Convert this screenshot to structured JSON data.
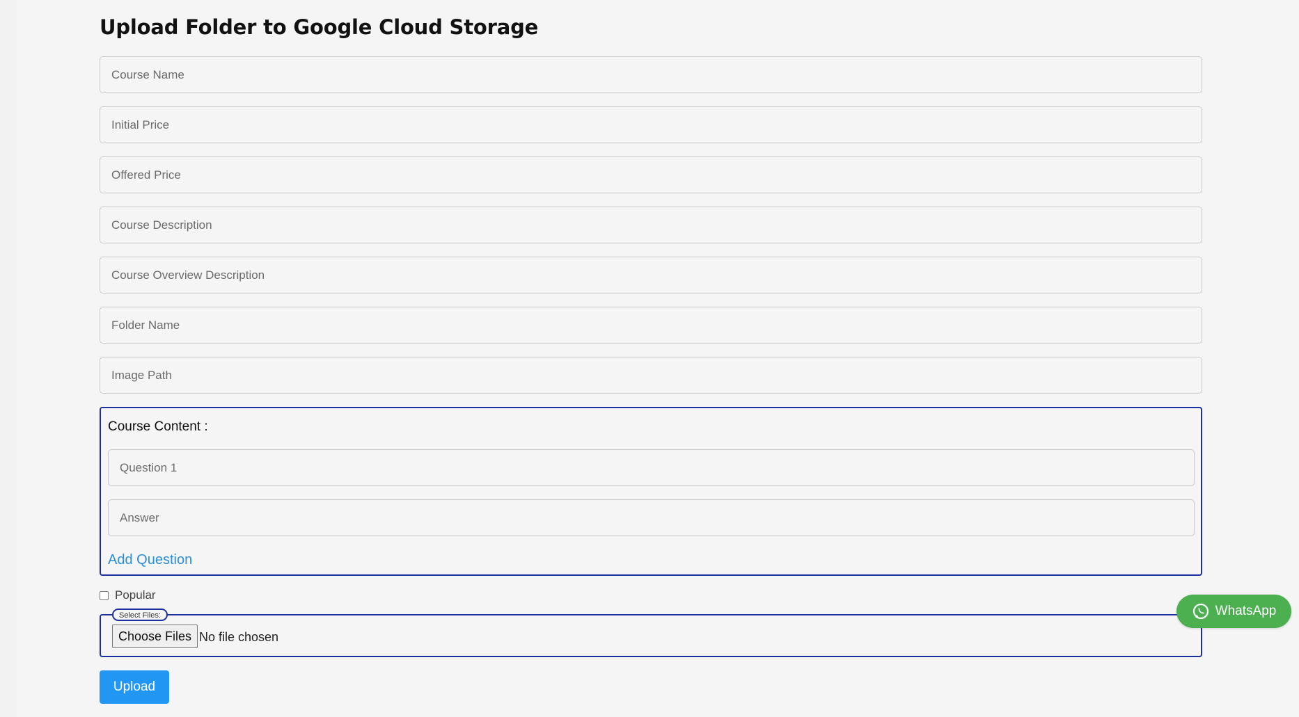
{
  "page": {
    "title": "Upload Folder to Google Cloud Storage"
  },
  "form": {
    "fields": [
      {
        "name": "course-name-input",
        "placeholder": "Course Name",
        "value": ""
      },
      {
        "name": "initial-price-input",
        "placeholder": "Initial Price",
        "value": ""
      },
      {
        "name": "offered-price-input",
        "placeholder": "Offered Price",
        "value": ""
      },
      {
        "name": "course-description-input",
        "placeholder": "Course Description",
        "value": ""
      },
      {
        "name": "course-overview-description-input",
        "placeholder": "Course Overview Description",
        "value": ""
      },
      {
        "name": "folder-name-input",
        "placeholder": "Folder Name",
        "value": ""
      },
      {
        "name": "image-path-input",
        "placeholder": "Image Path",
        "value": ""
      }
    ],
    "course_content": {
      "label": "Course Content :",
      "question_placeholder": "Question 1",
      "answer_placeholder": "Answer",
      "add_question_label": "Add Question"
    },
    "popular_label": "Popular",
    "popular_checked": false,
    "file_select": {
      "legend": "Select Files:",
      "button_label": "Choose Files",
      "status": "No file chosen"
    },
    "upload_label": "Upload"
  },
  "whatsapp": {
    "label": "WhatsApp",
    "icon": "whatsapp-icon"
  },
  "colors": {
    "accent_blue": "#2196f3",
    "border_blue": "#1b2fa0",
    "link_blue": "#2a8fd6",
    "whatsapp_green": "#4caf50",
    "background": "#f5f5f5"
  }
}
